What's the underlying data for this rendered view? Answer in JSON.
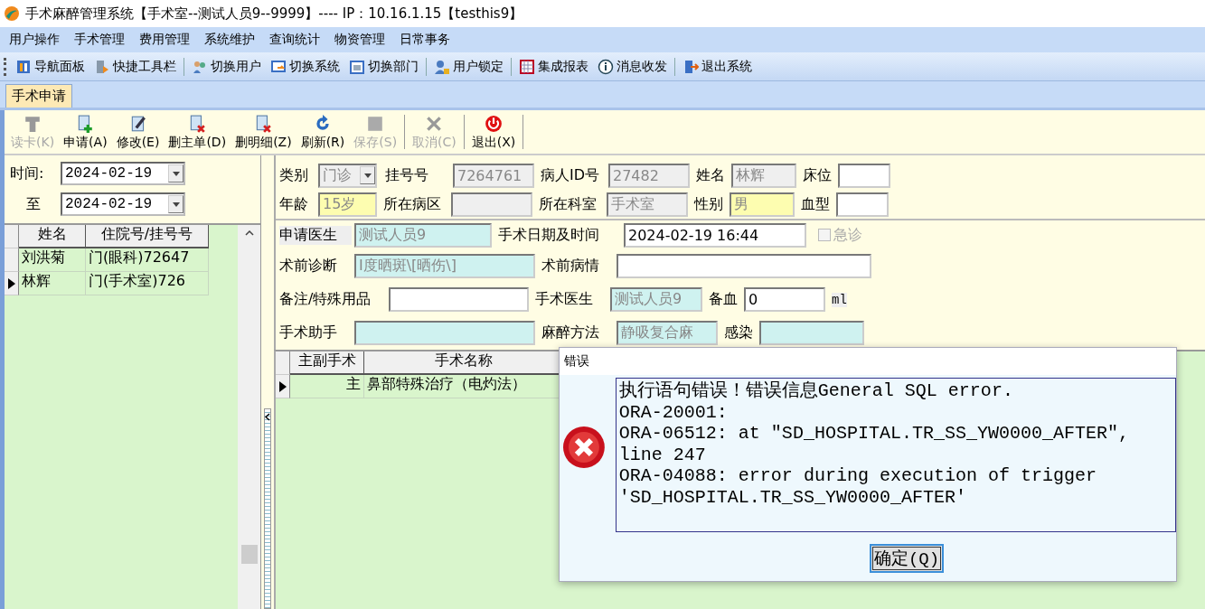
{
  "window": {
    "title": "手术麻醉管理系统【手术室--测试人员9--9999】---- IP：10.16.1.15【testhis9】"
  },
  "menu": [
    "用户操作",
    "手术管理",
    "费用管理",
    "系统维护",
    "查询统计",
    "物资管理",
    "日常事务"
  ],
  "toolbar": [
    "导航面板",
    "快捷工具栏",
    "切换用户",
    "切换系统",
    "切换部门",
    "用户锁定",
    "集成报表",
    "消息收发",
    "退出系统"
  ],
  "tabs": [
    {
      "label": "手术申请",
      "selected": true
    }
  ],
  "actions": [
    {
      "label": "读卡(K)",
      "disabled": true
    },
    {
      "label": "申请(A)",
      "disabled": false
    },
    {
      "label": "修改(E)",
      "disabled": false
    },
    {
      "label": "删主单(D)",
      "disabled": false
    },
    {
      "label": "删明细(Z)",
      "disabled": false
    },
    {
      "label": "刷新(R)",
      "disabled": false
    },
    {
      "label": "保存(S)",
      "disabled": true
    },
    {
      "label": "取消(C)",
      "disabled": true
    },
    {
      "label": "退出(X)",
      "disabled": false
    }
  ],
  "filter": {
    "from_label": "时间:",
    "from": "2024-02-19",
    "to_label": "至",
    "to": "2024-02-19"
  },
  "patients": {
    "columns": [
      "姓名",
      "住院号/挂号号"
    ],
    "rows": [
      {
        "cells": [
          "刘洪菊",
          "门(眼科)72647"
        ],
        "selected": false
      },
      {
        "cells": [
          "林辉",
          "门(手术室)726"
        ],
        "selected": true
      }
    ]
  },
  "form": {
    "rows": [
      {
        "items": [
          {
            "label": "类别",
            "value": "门诊",
            "kind": "select",
            "color": "#efefef"
          },
          {
            "label": "挂号号",
            "value": "7264761",
            "kind": "text",
            "color": "#efefef"
          },
          {
            "label": "病人ID号",
            "value": "27482",
            "kind": "text",
            "color": "#efefef"
          },
          {
            "label": "姓名",
            "value": "林辉",
            "kind": "text",
            "color": "#efefef"
          },
          {
            "label": "床位",
            "kind": "text",
            "color": "#ffffff"
          }
        ]
      },
      {
        "items": [
          {
            "label": "年龄",
            "value": "15岁",
            "kind": "text",
            "color": "#fdfdb0"
          },
          {
            "label": "所在病区",
            "kind": "text",
            "color": "#efefef"
          },
          {
            "label": "所在科室",
            "value": "手术室",
            "kind": "text",
            "color": "#efefef"
          },
          {
            "label": "性别",
            "value": "男",
            "kind": "text",
            "color": "#fdfdb0"
          },
          {
            "label": "血型",
            "kind": "text",
            "color": "#ffffff"
          }
        ]
      },
      {
        "items": [
          {
            "label": "申请医生",
            "value": "测试人员9",
            "kind": "text",
            "color": "#cff2f0"
          },
          {
            "label": "手术日期及时间",
            "value": "2024-02-19 16:44",
            "kind": "text",
            "color": "#ffffff"
          }
        ]
      },
      {
        "items": [
          {
            "label": "术前诊断",
            "value": "Ⅰ度晒斑\\[晒伤\\]",
            "kind": "text",
            "color": "#cff2f0"
          },
          {
            "label": "术前病情",
            "kind": "text",
            "color": "#ffffff"
          }
        ]
      },
      {
        "items": [
          {
            "label": "备注/特殊用品",
            "kind": "text",
            "color": "#ffffff"
          },
          {
            "label": "手术医生",
            "value": "测试人员9",
            "kind": "text",
            "color": "#cff2f0"
          },
          {
            "label": "备血",
            "value": "0",
            "kind": "text",
            "color": "#ffffff"
          }
        ]
      },
      {
        "items": [
          {
            "label": "手术助手",
            "kind": "text",
            "color": "#cff2f0"
          },
          {
            "label": "麻醉方法",
            "value": "静吸复合麻",
            "kind": "text",
            "color": "#cff2f0"
          },
          {
            "label": "感染",
            "kind": "text",
            "color": "#cff2f0"
          }
        ]
      }
    ],
    "urgent": {
      "label": "急诊",
      "checked": false,
      "disabled": true
    },
    "blood_unit": "ml"
  },
  "surgeries": {
    "columns": [
      "主副手术",
      "手术名称"
    ],
    "rows": [
      {
        "cells": [
          "主",
          "鼻部特殊治疗（电灼法）"
        ],
        "selected": true
      }
    ]
  },
  "dialog": {
    "title": "错误",
    "lines": [
      "执行语句错误！错误信息General SQL error.",
      "ORA-20001:",
      "ORA-06512: at \"SD_HOSPITAL.TR_SS_YW0000_AFTER\",",
      "line 247",
      "ORA-04088: error during execution of trigger",
      "'SD_HOSPITAL.TR_SS_YW0000_AFTER'"
    ],
    "button": "确定(Q)"
  }
}
